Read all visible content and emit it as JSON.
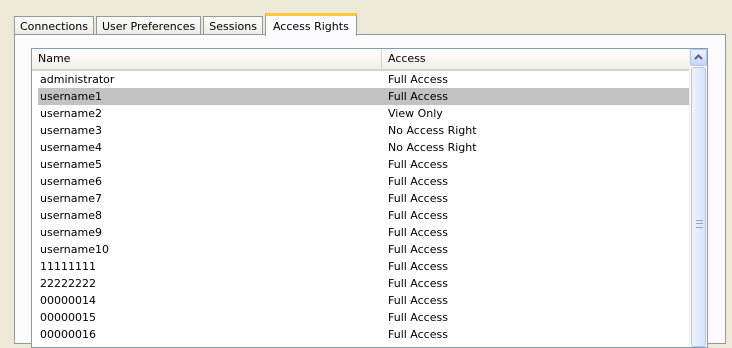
{
  "tabs": [
    {
      "label": "Connections"
    },
    {
      "label": "User Preferences"
    },
    {
      "label": "Sessions"
    },
    {
      "label": "Access Rights"
    }
  ],
  "table": {
    "columns": [
      "Name",
      "Access"
    ],
    "rows": [
      {
        "name": "administrator",
        "access": "Full Access"
      },
      {
        "name": "username1",
        "access": "Full Access"
      },
      {
        "name": "username2",
        "access": "View Only"
      },
      {
        "name": "username3",
        "access": "No Access Right"
      },
      {
        "name": "username4",
        "access": "No Access Right"
      },
      {
        "name": "username5",
        "access": "Full Access"
      },
      {
        "name": "username6",
        "access": "Full Access"
      },
      {
        "name": "username7",
        "access": "Full Access"
      },
      {
        "name": "username8",
        "access": "Full Access"
      },
      {
        "name": "username9",
        "access": "Full Access"
      },
      {
        "name": "username10",
        "access": "Full Access"
      },
      {
        "name": "11111111",
        "access": "Full Access"
      },
      {
        "name": "22222222",
        "access": "Full Access"
      },
      {
        "name": "00000014",
        "access": "Full Access"
      },
      {
        "name": "00000015",
        "access": "Full Access"
      },
      {
        "name": "00000016",
        "access": "Full Access"
      }
    ]
  },
  "icons": {
    "scroll_up": "chevron-up-icon",
    "grip": "scroll-grip-icon"
  }
}
